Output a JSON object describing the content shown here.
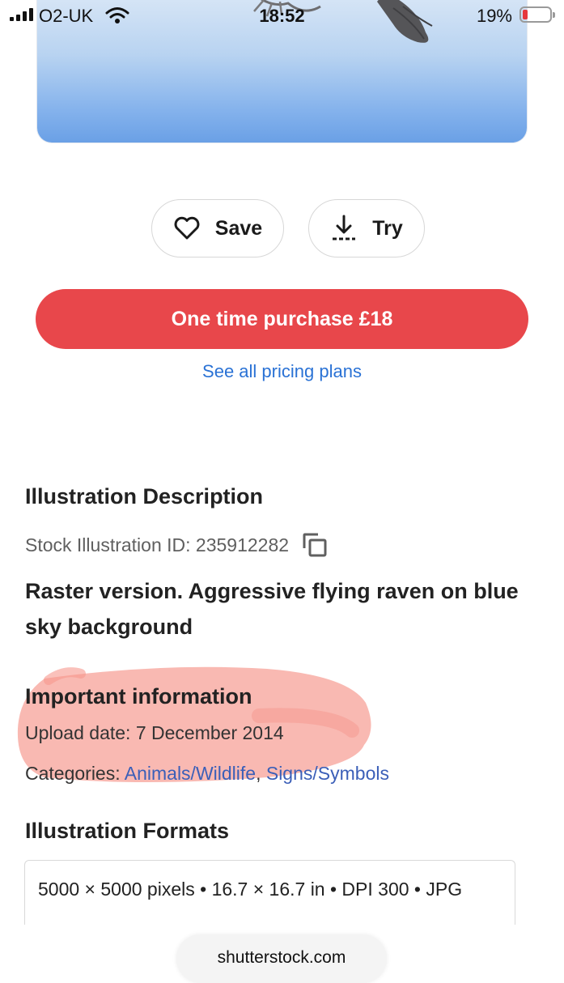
{
  "status_bar": {
    "carrier": "O2-UK",
    "time": "18:52",
    "battery_percent": "19%",
    "battery_level": 0.19,
    "battery_color": "#e6383d"
  },
  "hero": {
    "icon": "raven-illustration"
  },
  "actions": {
    "save_label": "Save",
    "save_icon": "heart-outline-icon",
    "try_label": "Try",
    "try_icon": "download-icon"
  },
  "purchase": {
    "button_label": "One time purchase £18",
    "button_color": "#e8474b",
    "pricing_link": "See all pricing plans",
    "link_color": "#2a72d5"
  },
  "description": {
    "heading": "Illustration Description",
    "stock_id_label": "Stock Illustration ID: 235912282",
    "copy_icon": "copy-icon",
    "text": "Raster version. Aggressive flying raven on blue sky background"
  },
  "important": {
    "heading": "Important information",
    "upload_date": "Upload date: 7 December 2014",
    "categories_label": "Categories: ",
    "categories": [
      "Animals/Wildlife",
      "Signs/Symbols"
    ],
    "separator": ", ",
    "highlight_color": "#f7a59c"
  },
  "formats": {
    "heading": "Illustration Formats",
    "first_format": "5000 × 5000 pixels • 16.7 × 16.7 in • DPI 300 • JPG"
  },
  "browser": {
    "url": "shutterstock.com"
  }
}
